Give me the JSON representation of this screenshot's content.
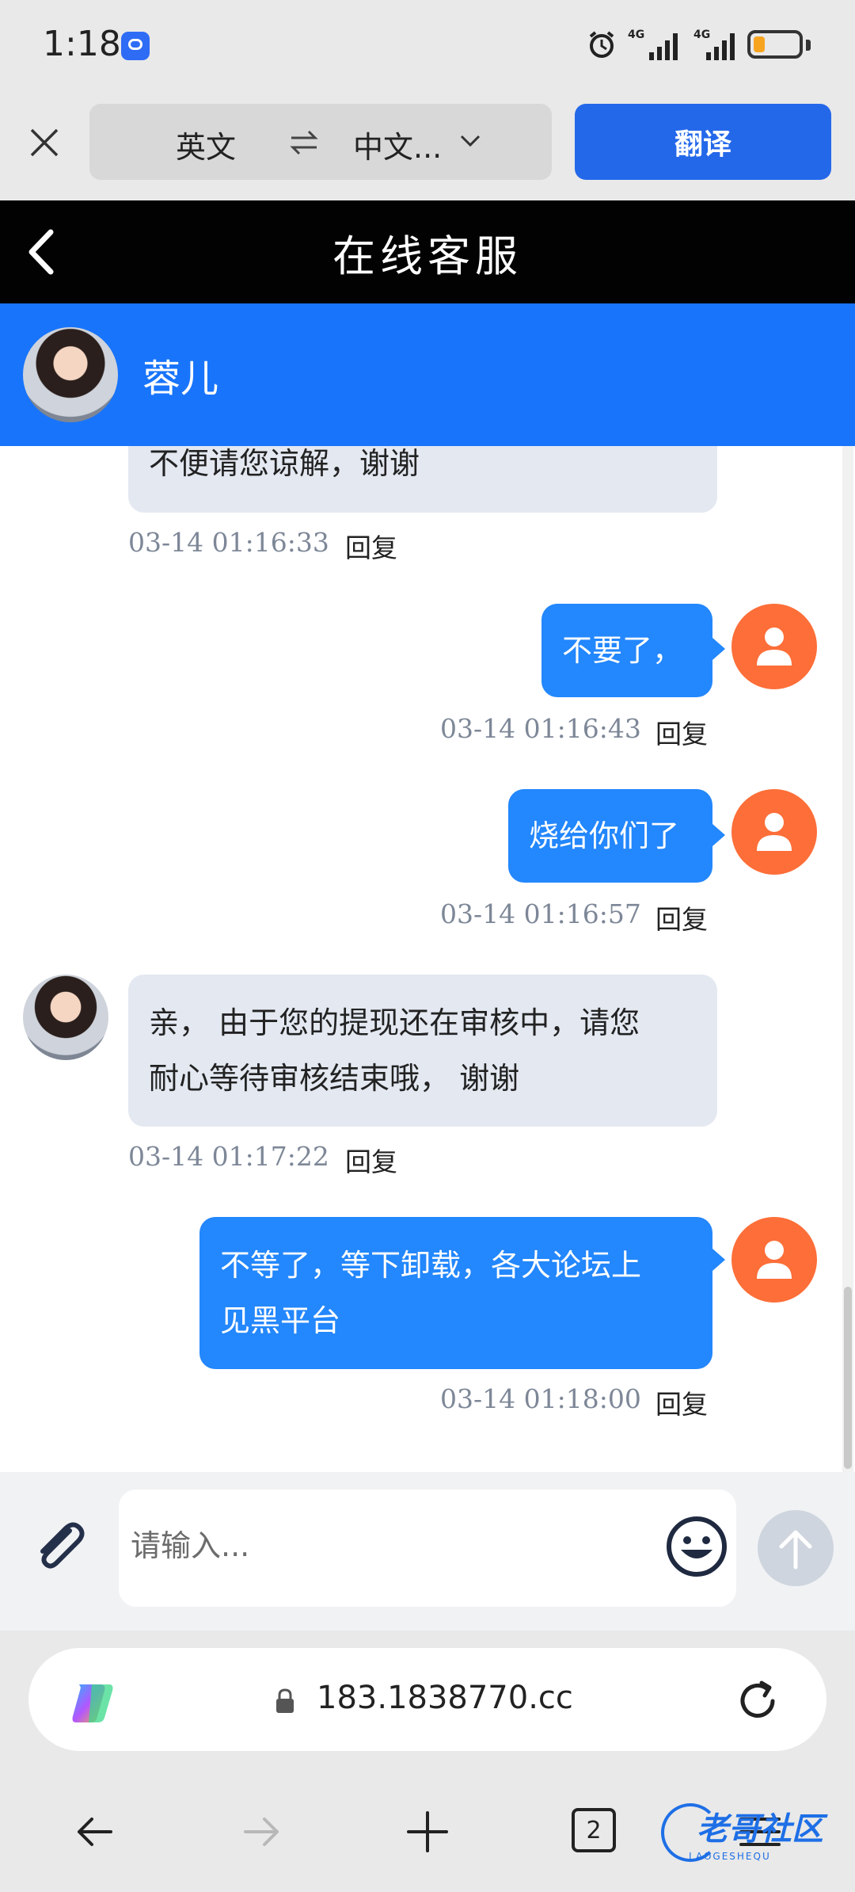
{
  "status_bar": {
    "time": "1:18",
    "network_1": "4G",
    "network_2": "4G"
  },
  "translate_bar": {
    "source_lang": "英文",
    "target_lang": "中文...",
    "translate_button": "翻译"
  },
  "chat_header": {
    "title": "在线客服"
  },
  "agent": {
    "name": "蓉儿"
  },
  "messages": [
    {
      "side": "in",
      "lines": [
        "不便请您谅解，谢谢"
      ],
      "time": "03-14 01:16:33",
      "reply": "回复"
    },
    {
      "side": "out",
      "lines": [
        "不要了，"
      ],
      "time": "03-14 01:16:43",
      "reply": "回复"
    },
    {
      "side": "out",
      "lines": [
        "烧给你们了"
      ],
      "time": "03-14 01:16:57",
      "reply": "回复"
    },
    {
      "side": "in",
      "lines": [
        "亲， 由于您的提现还在审核中，请您",
        "耐心等待审核结束哦， 谢谢"
      ],
      "time": "03-14 01:17:22",
      "reply": "回复"
    },
    {
      "side": "out",
      "lines": [
        "不等了，等下卸载，各大论坛上",
        "见黑平台"
      ],
      "time": "03-14 01:18:00",
      "reply": "回复"
    }
  ],
  "input": {
    "placeholder": "请输入..."
  },
  "browser": {
    "url": "183.1838770.cc",
    "tab_count": "2"
  },
  "watermark": {
    "text": "老哥社区",
    "sub": "LAOGESHEQU"
  },
  "colors": {
    "agent_bar": "#1874fb",
    "out_bubble": "#2387fd",
    "in_bubble": "#e3e8f1",
    "user_avatar": "#fd6e38",
    "translate_button": "#2468ea"
  }
}
